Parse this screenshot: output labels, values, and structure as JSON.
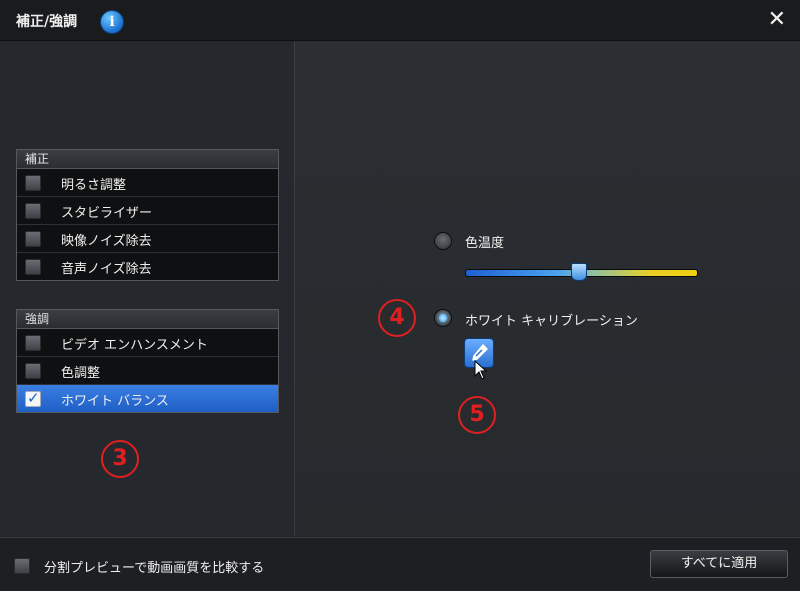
{
  "window": {
    "title": "補正/強調",
    "info_icon": "i",
    "close_icon": "✕"
  },
  "correction_group": {
    "header": "補正",
    "items": [
      {
        "label": "明るさ調整",
        "checked": false
      },
      {
        "label": "スタビライザー",
        "checked": false
      },
      {
        "label": "映像ノイズ除去",
        "checked": false
      },
      {
        "label": "音声ノイズ除去",
        "checked": false
      }
    ]
  },
  "enhance_group": {
    "header": "強調",
    "items": [
      {
        "label": "ビデオ エンハンスメント",
        "checked": false
      },
      {
        "label": "色調整",
        "checked": false
      },
      {
        "label": "ホワイト バランス",
        "checked": true,
        "selected": true
      }
    ]
  },
  "white_balance": {
    "color_temp_label": "色温度",
    "color_temp_selected": false,
    "slider_value_fraction": 0.49,
    "white_calibration_label": "ホワイト キャリブレーション",
    "white_calibration_selected": true,
    "eyedropper_icon": "eyedropper-icon"
  },
  "annotations": {
    "marker_3": "3",
    "marker_4": "4",
    "marker_5": "5",
    "color": "#e02020"
  },
  "bottom": {
    "compare_label": "分割プレビューで動画画質を比較する",
    "compare_checked": false,
    "apply_all_label": "すべてに適用"
  },
  "colors": {
    "accent": "#2a6fd0",
    "selection": "#1e5fc6",
    "background": "#25282c"
  }
}
